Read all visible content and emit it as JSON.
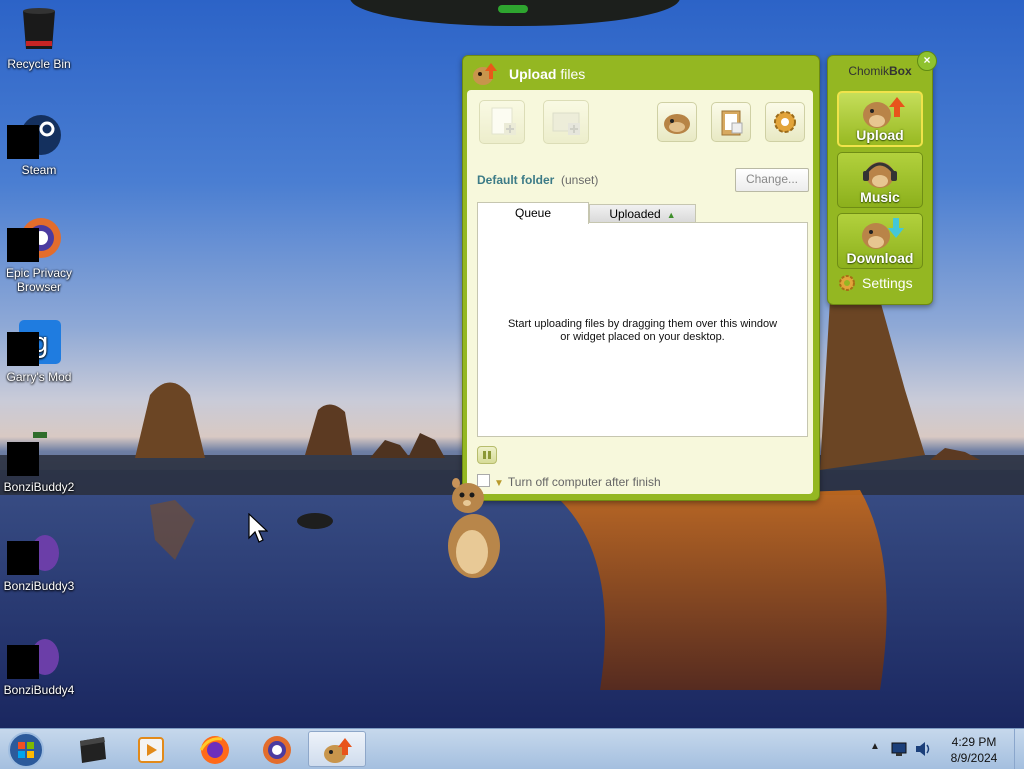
{
  "desktop": {
    "icons": [
      {
        "id": "recycle-bin",
        "label": "Recycle Bin"
      },
      {
        "id": "steam",
        "label": "Steam"
      },
      {
        "id": "epic",
        "label": "Epic Privacy Browser"
      },
      {
        "id": "gmod",
        "label": "Garry's Mod"
      },
      {
        "id": "bonzi2",
        "label": "BonziBuddy2"
      },
      {
        "id": "bonzi3",
        "label": "BonziBuddy3"
      },
      {
        "id": "bonzi4",
        "label": "BonziBuddy4"
      }
    ]
  },
  "upload_window": {
    "title_bold": "Upload",
    "title_rest": " files",
    "default_folder_label": "Default folder",
    "default_folder_value": "(unset)",
    "change_button": "Change...",
    "tabs": [
      {
        "label": "Queue",
        "active": true
      },
      {
        "label": "Uploaded",
        "active": false
      }
    ],
    "queue_message": "Start uploading files by dragging them over this window or widget placed on your desktop.",
    "turn_off_label": "Turn off computer after finish",
    "toolbar_icons": [
      "add-file-icon",
      "add-folder-icon",
      "chomik-icon",
      "clipboard-add-icon",
      "gear-icon"
    ]
  },
  "chomikbox_widget": {
    "title_part1": "Chomik",
    "title_part2": "Box",
    "close_glyph": "×",
    "buttons": [
      {
        "label": "Upload",
        "selected": true
      },
      {
        "label": "Music",
        "selected": false
      },
      {
        "label": "Download",
        "selected": false
      }
    ],
    "settings_label": "Settings"
  },
  "taskbar": {
    "apps": [
      "start-orb-icon",
      "terminal-icon",
      "media-player-icon",
      "firefox-icon",
      "epic-browser-icon",
      "chomikbox-icon"
    ],
    "time": "4:29 PM",
    "date": "8/9/2024"
  },
  "colors": {
    "window_green": "#94b722",
    "window_body": "#f7f8dc",
    "folder_label": "#3c7b87"
  }
}
